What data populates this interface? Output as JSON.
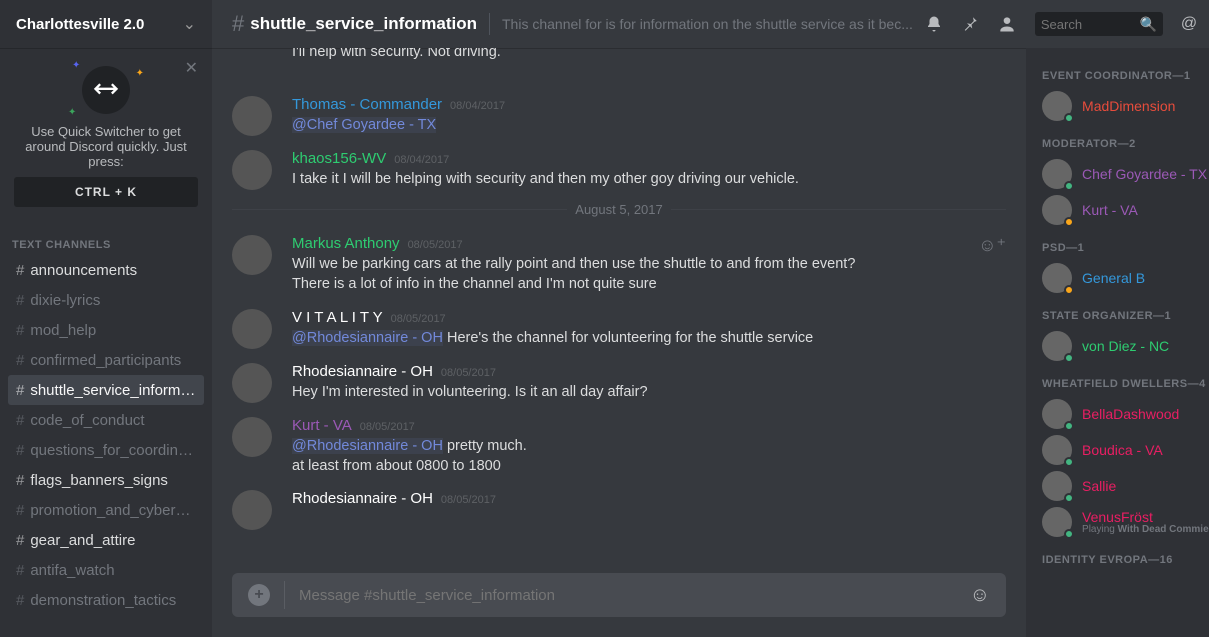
{
  "server": {
    "name": "Charlottesville 2.0"
  },
  "quick_switch": {
    "tip": "Use Quick Switcher to get around Discord quickly. Just press:",
    "kbd": "CTRL + K"
  },
  "channels": {
    "header": "TEXT CHANNELS",
    "items": [
      {
        "name": "announcements",
        "unread": true,
        "active": false
      },
      {
        "name": "dixie-lyrics",
        "unread": false,
        "active": false
      },
      {
        "name": "mod_help",
        "unread": false,
        "active": false
      },
      {
        "name": "confirmed_participants",
        "unread": false,
        "active": false
      },
      {
        "name": "shuttle_service_informat...",
        "unread": true,
        "active": true
      },
      {
        "name": "code_of_conduct",
        "unread": false,
        "active": false
      },
      {
        "name": "questions_for_coordinat...",
        "unread": false,
        "active": false
      },
      {
        "name": "flags_banners_signs",
        "unread": true,
        "active": false
      },
      {
        "name": "promotion_and_cyberstr...",
        "unread": false,
        "active": false
      },
      {
        "name": "gear_and_attire",
        "unread": true,
        "active": false
      },
      {
        "name": "antifa_watch",
        "unread": false,
        "active": false
      },
      {
        "name": "demonstration_tactics",
        "unread": false,
        "active": false
      }
    ]
  },
  "topbar": {
    "channel": "shuttle_service_information",
    "topic": "This channel for is for information on the shuttle service as it bec...",
    "search_placeholder": "Search"
  },
  "divider_date": "August 5, 2017",
  "messages": [
    {
      "author": "",
      "color": "#fff",
      "ts": "",
      "body": "I'll help with security. Not driving.",
      "partial": true
    },
    {
      "author": "Thomas - Commander",
      "color": "#3498db",
      "ts": "08/04/2017",
      "body": "",
      "mention": "@Chef Goyardee - TX"
    },
    {
      "author": "khaos156-WV",
      "color": "#2ecc71",
      "ts": "08/04/2017",
      "body": "I take it I will be helping with security and then my other goy driving our vehicle."
    },
    {
      "divider": true
    },
    {
      "author": "Markus Anthony",
      "color": "#2ecc71",
      "ts": "08/05/2017",
      "body": "Will we be parking cars at the rally point and then use the shuttle to and from the event?\nThere is a lot of info in the channel and I'm not quite sure",
      "hover": true
    },
    {
      "author": "V I T A L I T Y",
      "color": "#fefefe",
      "ts": "08/05/2017",
      "mention": "@Rhodesiannaire - OH",
      "body_after": " Here's the channel for volunteering for the shuttle service"
    },
    {
      "author": "Rhodesiannaire - OH",
      "color": "#fefefe",
      "ts": "08/05/2017",
      "body": "Hey I'm interested in volunteering. Is it an all day affair?"
    },
    {
      "author": "Kurt - VA",
      "color": "#9b59b6",
      "ts": "08/05/2017",
      "mention": "@Rhodesiannaire - OH",
      "body_after": " pretty much.\nat least from about 0800 to 1800"
    },
    {
      "author": "Rhodesiannaire - OH",
      "color": "#fefefe",
      "ts": "08/05/2017",
      "body": ""
    }
  ],
  "compose": {
    "placeholder": "Message #shuttle_service_information"
  },
  "members": {
    "groups": [
      {
        "role": "EVENT COORDINATOR—1",
        "list": [
          {
            "name": "MadDimension",
            "color": "#e74c3c",
            "status": "online"
          }
        ]
      },
      {
        "role": "MODERATOR—2",
        "list": [
          {
            "name": "Chef Goyardee - TX",
            "color": "#9b59b6",
            "status": "online"
          },
          {
            "name": "Kurt - VA",
            "color": "#9b59b6",
            "status": "idle"
          }
        ]
      },
      {
        "role": "PSD—1",
        "list": [
          {
            "name": "General B",
            "color": "#3498db",
            "status": "idle"
          }
        ]
      },
      {
        "role": "STATE ORGANIZER—1",
        "list": [
          {
            "name": "von Diez - NC",
            "color": "#2ecc71",
            "status": "online"
          }
        ]
      },
      {
        "role": "WHEATFIELD DWELLERS—4",
        "list": [
          {
            "name": "BellaDashwood",
            "color": "#e91e63",
            "status": "online"
          },
          {
            "name": "Boudica - VA",
            "color": "#e91e63",
            "status": "online"
          },
          {
            "name": "Sallie",
            "color": "#e91e63",
            "status": "online"
          },
          {
            "name": "VenusFröst",
            "color": "#e91e63",
            "status": "online",
            "sub_prefix": "Playing ",
            "sub_bold": "With Dead Commies"
          }
        ]
      },
      {
        "role": "IDENTITY EVROPA—16",
        "list": []
      }
    ]
  }
}
